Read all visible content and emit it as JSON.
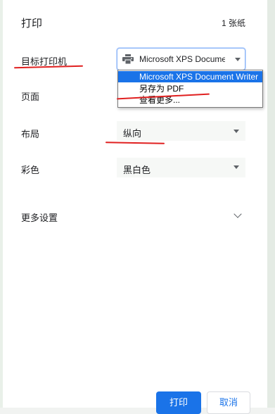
{
  "dialog": {
    "title": "打印",
    "sheet_count": "1 张纸"
  },
  "destination": {
    "label": "目标打印机",
    "value": "Microsoft XPS Document Writer",
    "icon": "printer-icon",
    "options": [
      "Microsoft XPS Document Writer",
      "另存为 PDF",
      "查看更多..."
    ],
    "selected_index": 0
  },
  "pages": {
    "label": "页面"
  },
  "layout": {
    "label": "布局",
    "value": "纵向"
  },
  "color": {
    "label": "彩色",
    "value": "黑白色"
  },
  "more_settings": {
    "label": "更多设置"
  },
  "buttons": {
    "print": "打印",
    "cancel": "取消"
  },
  "colors": {
    "accent": "#1a73e8",
    "annotation": "#e02020"
  }
}
